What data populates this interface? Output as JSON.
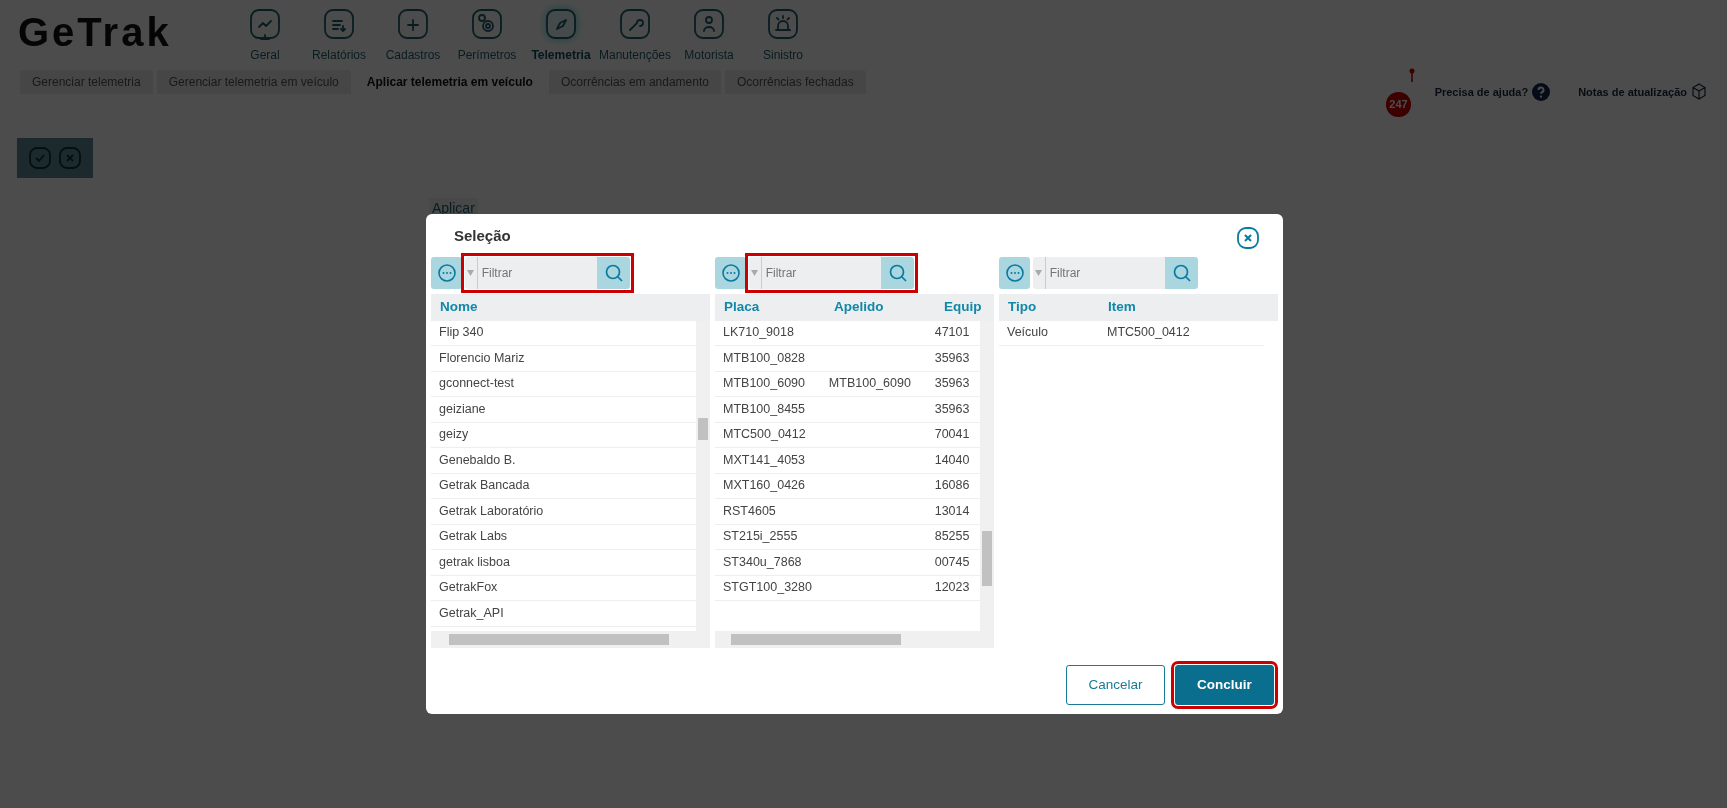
{
  "logo": "GeTrak",
  "nav": [
    {
      "label": "Geral",
      "selected": false
    },
    {
      "label": "Relatórios",
      "selected": false
    },
    {
      "label": "Cadastros",
      "selected": false
    },
    {
      "label": "Perímetros",
      "selected": false
    },
    {
      "label": "Telemetria",
      "selected": true
    },
    {
      "label": "Manutenções",
      "selected": false
    },
    {
      "label": "Motorista",
      "selected": false
    },
    {
      "label": "Sinistro",
      "selected": false
    }
  ],
  "subtabs": [
    {
      "label": "Gerenciar telemetria",
      "selected": false
    },
    {
      "label": "Gerenciar telemetria em veículo",
      "selected": false
    },
    {
      "label": "Aplicar telemetria em veículo",
      "selected": true
    },
    {
      "label": "Ocorrências em andamento",
      "selected": false
    },
    {
      "label": "Ocorrências fechadas",
      "selected": false
    }
  ],
  "alert_count": "247",
  "help": "Precisa de ajuda?",
  "notes": "Notas de atualização",
  "section_label": "Aplicar",
  "modal": {
    "title": "Seleção",
    "panels": [
      {
        "filter": {
          "placeholder": "Filtrar",
          "highlighted": true
        },
        "scrollable": true,
        "columns": [
          "Nome"
        ],
        "rows": [
          [
            "Flip 340"
          ],
          [
            "Florencio Mariz"
          ],
          [
            "gconnect-test"
          ],
          [
            "geiziane"
          ],
          [
            "geizy"
          ],
          [
            "Genebaldo B."
          ],
          [
            "Getrak Bancada"
          ],
          [
            "Getrak Laboratório"
          ],
          [
            "Getrak Labs"
          ],
          [
            "getrak lisboa"
          ],
          [
            "GetrakFox"
          ],
          [
            "Getrak_API"
          ]
        ]
      },
      {
        "filter": {
          "placeholder": "Filtrar",
          "highlighted": true
        },
        "scrollable": true,
        "columns": [
          "Placa",
          "Apelido",
          "Equip"
        ],
        "rows": [
          [
            "LK710_9018",
            "",
            "47101"
          ],
          [
            "MTB100_0828",
            "",
            "35963"
          ],
          [
            "MTB100_6090",
            "MTB100_6090",
            "35963"
          ],
          [
            "MTB100_8455",
            "",
            "35963"
          ],
          [
            "MTC500_0412",
            "",
            "70041"
          ],
          [
            "MXT141_4053",
            "",
            "14040"
          ],
          [
            "MXT160_0426",
            "",
            "16086"
          ],
          [
            "RST4605",
            "",
            "13014"
          ],
          [
            "ST215i_2555",
            "",
            "85255"
          ],
          [
            "ST340u_7868",
            "",
            "00745"
          ],
          [
            "STGT100_3280",
            "",
            "12023"
          ]
        ]
      },
      {
        "filter": {
          "placeholder": "Filtrar",
          "highlighted": false
        },
        "scrollable": false,
        "columns": [
          "Tipo",
          "Item"
        ],
        "rows": [
          [
            "Veículo",
            "MTC500_0412"
          ]
        ]
      }
    ],
    "buttons": [
      {
        "label": "Cancelar",
        "kind": "secondary",
        "highlighted": false
      },
      {
        "label": "Concluir",
        "kind": "primary",
        "highlighted": true
      }
    ]
  }
}
